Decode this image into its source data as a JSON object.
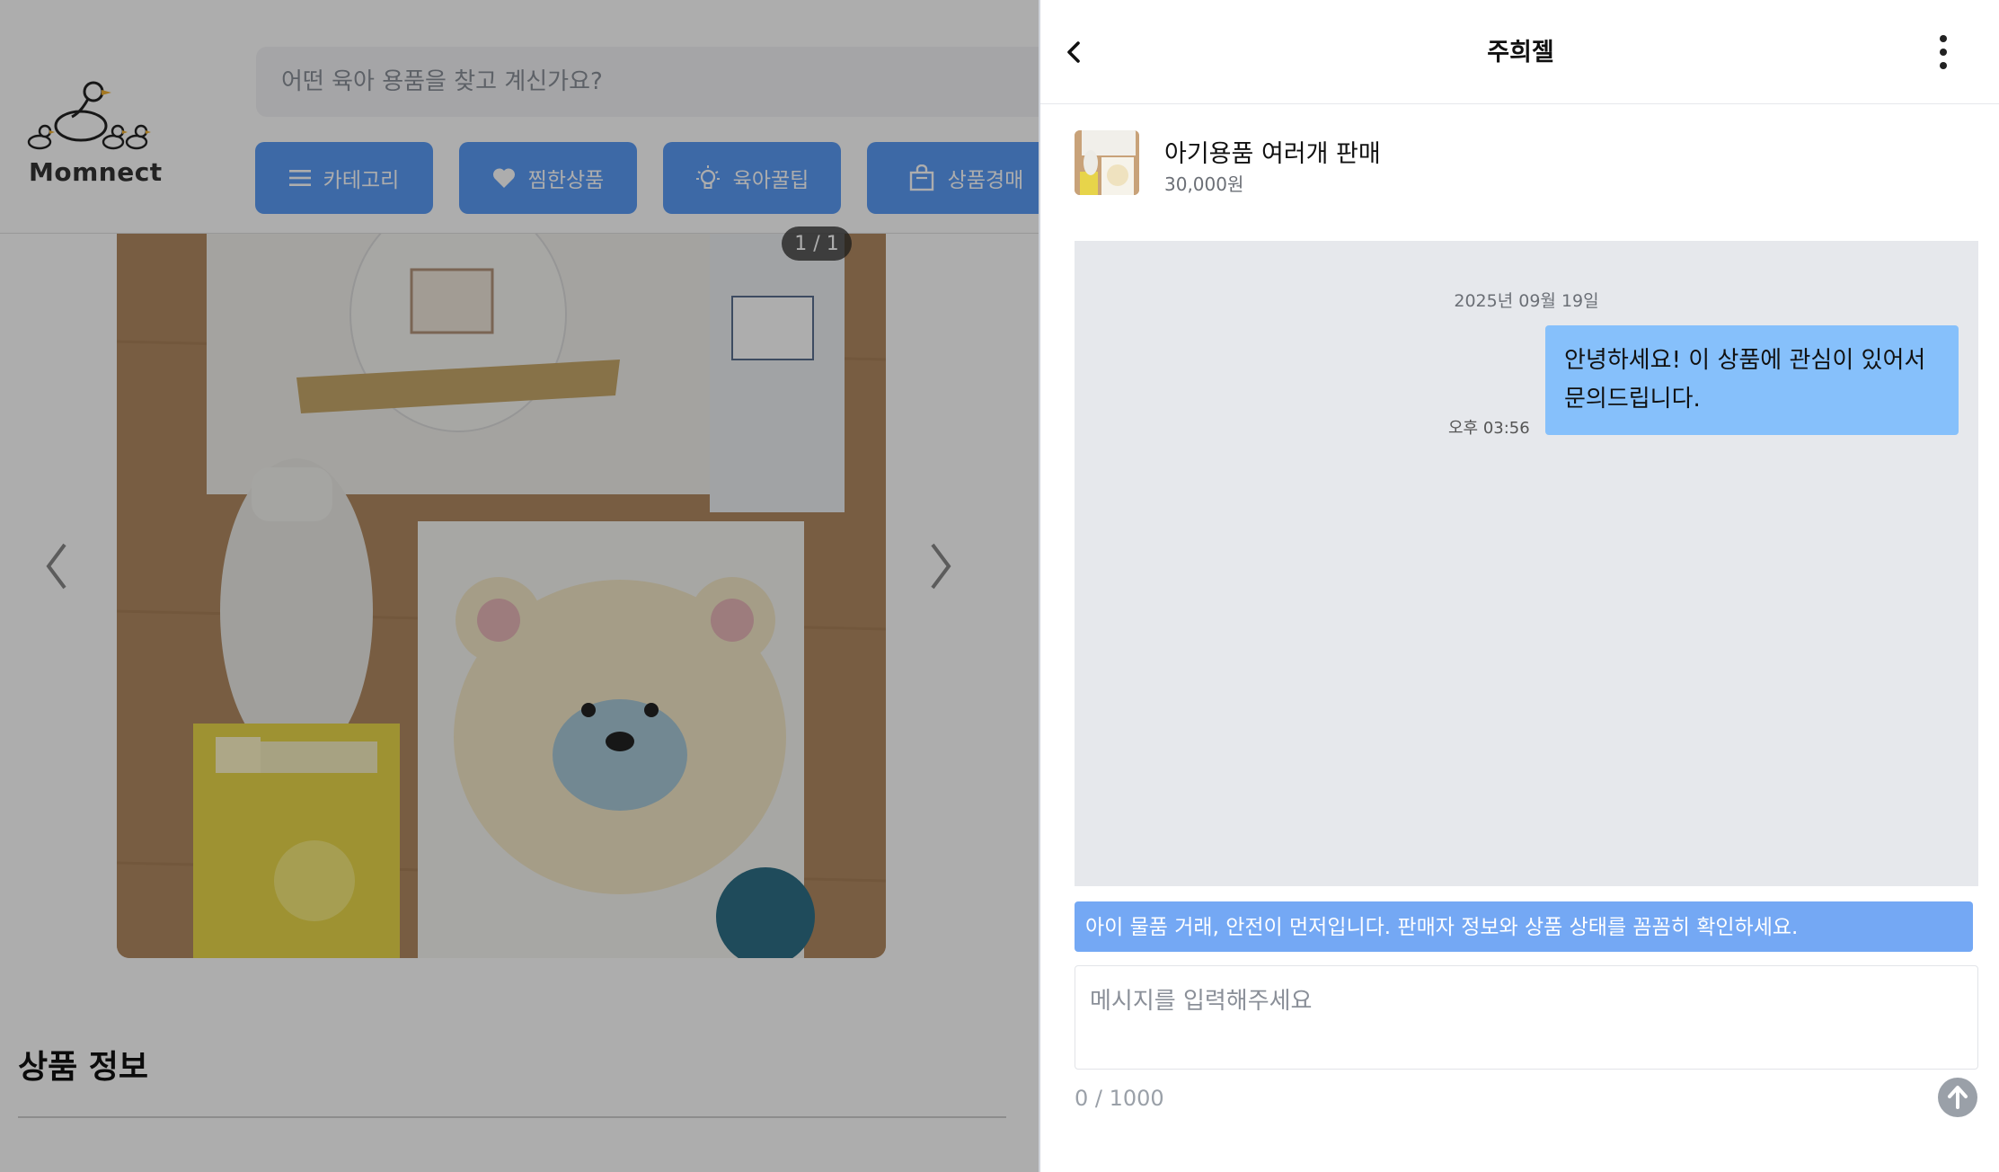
{
  "background_page": {
    "logo_text": "Momnect",
    "search": {
      "placeholder": "어떤 육아 용품을 찾고 계신가요?"
    },
    "nav": [
      {
        "label": "카테고리",
        "icon": "menu-icon"
      },
      {
        "label": "찜한상품",
        "icon": "heart-icon"
      },
      {
        "label": "육아꿀팁",
        "icon": "lightbulb-icon"
      },
      {
        "label": "상품경매",
        "icon": "shopping-bag-icon"
      }
    ],
    "image_counter": "1 / 1",
    "section_title": "상품 정보"
  },
  "chat": {
    "title": "주희젤",
    "product": {
      "name": "아기용품 여러개 판매",
      "price": "30,000원"
    },
    "date_divider": "2025년 09월 19일",
    "messages": [
      {
        "text": "안녕하세요! 이 상품에 관심이 있어서 문의드립니다.",
        "time": "오후 03:56",
        "sender": "me"
      }
    ],
    "safety_notice": "아이 물품 거래, 안전이 먼저입니다. 판매자 정보와 상품 상태를 꼼꼼히 확인하세요.",
    "input": {
      "placeholder": "메시지를 입력해주세요"
    },
    "char_counter": "0 / 1000"
  },
  "colors": {
    "accent": "#5b9bf5",
    "bubble": "#86c0fb",
    "notice": "#74a8f4",
    "message_area": "#e6e8ec"
  }
}
